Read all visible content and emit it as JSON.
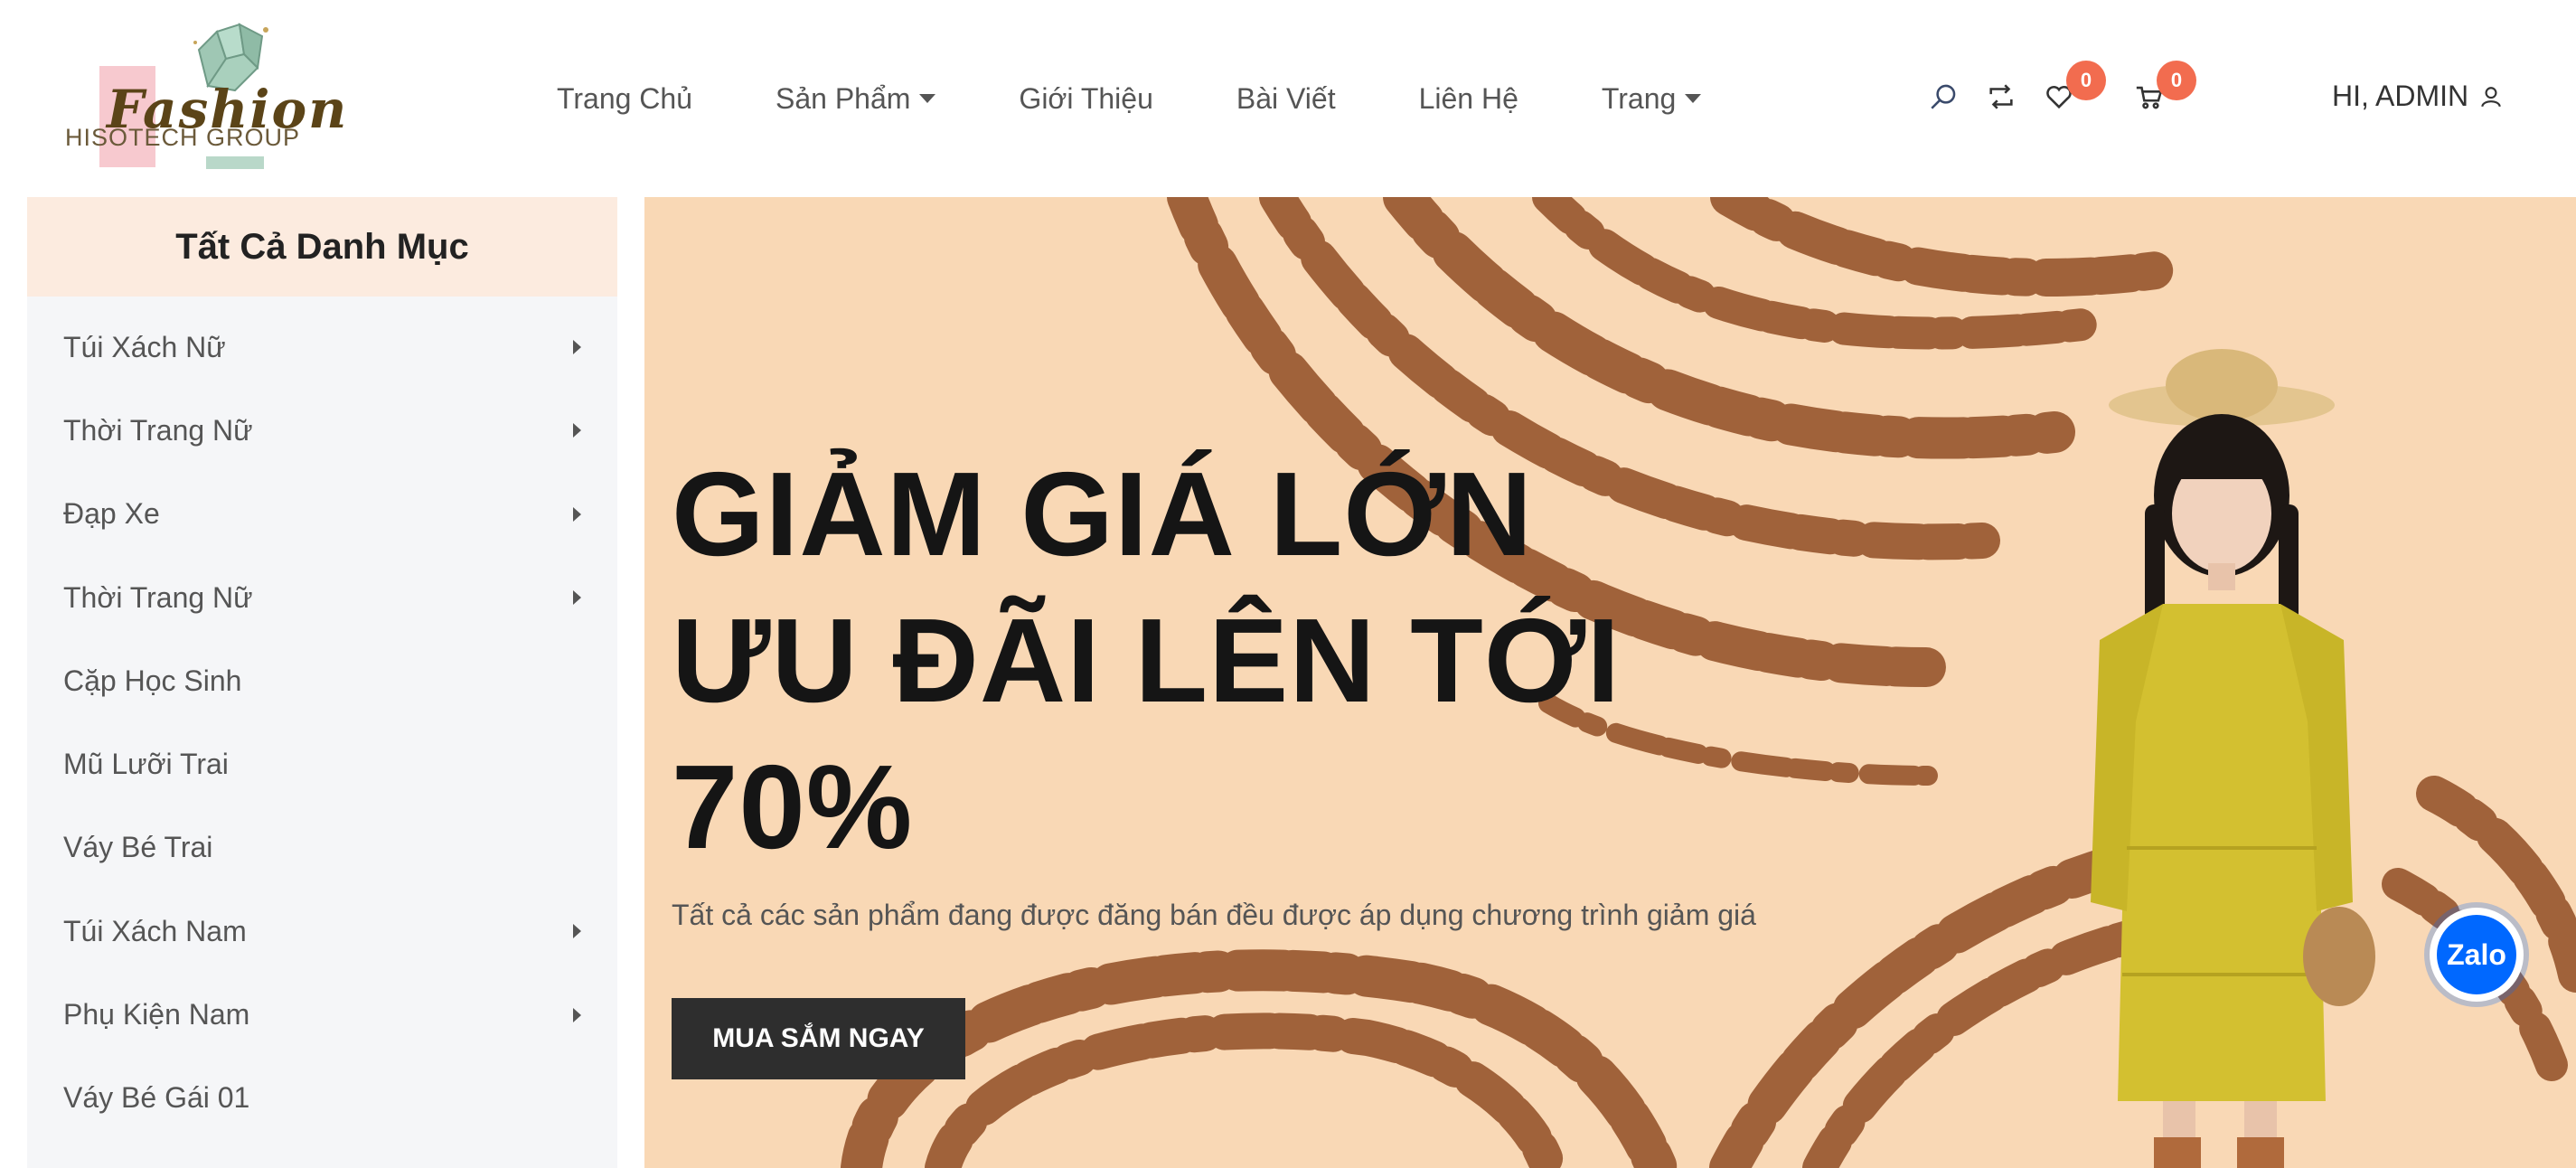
{
  "brand": {
    "logo_script": "Fashion",
    "logo_group": "HISOTECH GROUP"
  },
  "nav": {
    "items": [
      {
        "label": "Trang Chủ",
        "dropdown": false
      },
      {
        "label": "Sản Phẩm",
        "dropdown": true
      },
      {
        "label": "Giới Thiệu",
        "dropdown": false
      },
      {
        "label": "Bài Viết",
        "dropdown": false
      },
      {
        "label": "Liên Hệ",
        "dropdown": false
      },
      {
        "label": "Trang",
        "dropdown": true
      }
    ]
  },
  "tools": {
    "icons": [
      "search-icon",
      "compare-icon",
      "heart-icon",
      "cart-icon",
      "user-icon"
    ],
    "wishlist_count": "0",
    "cart_count": "0",
    "badge_color": "#f26c4f"
  },
  "account": {
    "greeting": "HI, ADMIN"
  },
  "sidebar": {
    "title": "Tất Cả Danh Mục",
    "items": [
      {
        "label": "Túi Xách Nữ",
        "has_sub": true
      },
      {
        "label": "Thời Trang Nữ",
        "has_sub": true
      },
      {
        "label": "Đạp Xe",
        "has_sub": true
      },
      {
        "label": "Thời Trang Nữ",
        "has_sub": true
      },
      {
        "label": "Cặp Học Sinh",
        "has_sub": false
      },
      {
        "label": "Mũ Lưỡi Trai",
        "has_sub": false
      },
      {
        "label": "Váy Bé Trai",
        "has_sub": false
      },
      {
        "label": "Túi Xách Nam",
        "has_sub": true
      },
      {
        "label": "Phụ Kiện Nam",
        "has_sub": true
      },
      {
        "label": "Váy Bé Gái 01",
        "has_sub": false
      }
    ]
  },
  "hero": {
    "title_lines": [
      "GIẢM GIÁ LỚN",
      "ƯU ĐÃI LÊN TỚI",
      "70%"
    ],
    "subtitle": "Tất cả các sản phẩm đang được đăng bán đều được áp dụng chương trình giảm giá",
    "cta": "MUA SẮM NGAY",
    "bg_color": "#f9d8b5",
    "pattern_color": "#a0623a"
  },
  "zalo": {
    "label": "Zalo",
    "color": "#0068ff"
  }
}
